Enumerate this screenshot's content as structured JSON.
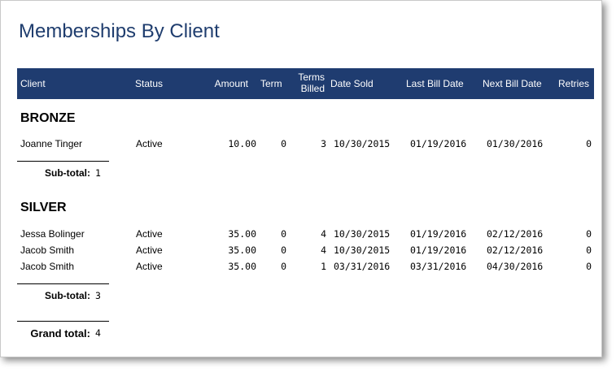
{
  "report": {
    "title": "Memberships By Client"
  },
  "header": {
    "client": "Client",
    "status": "Status",
    "amount": "Amount",
    "term": "Term",
    "terms_billed_line1": "Terms",
    "terms_billed_line2": "Billed",
    "date_sold": "Date Sold",
    "last_bill_date": "Last Bill Date",
    "next_bill_date": "Next Bill Date",
    "retries": "Retries"
  },
  "groups": [
    {
      "name": "BRONZE",
      "rows": [
        {
          "client": "Joanne Tinger",
          "status": "Active",
          "amount": "10.00",
          "term": "0",
          "terms_billed": "3",
          "date_sold": "10/30/2015",
          "last_bill_date": "01/19/2016",
          "next_bill_date": "01/30/2016",
          "retries": "0"
        }
      ],
      "subtotal_label": "Sub-total:",
      "subtotal_value": "1"
    },
    {
      "name": "SILVER",
      "rows": [
        {
          "client": "Jessa Bolinger",
          "status": "Active",
          "amount": "35.00",
          "term": "0",
          "terms_billed": "4",
          "date_sold": "10/30/2015",
          "last_bill_date": "01/19/2016",
          "next_bill_date": "02/12/2016",
          "retries": "0"
        },
        {
          "client": "Jacob Smith",
          "status": "Active",
          "amount": "35.00",
          "term": "0",
          "terms_billed": "4",
          "date_sold": "10/30/2015",
          "last_bill_date": "01/19/2016",
          "next_bill_date": "02/12/2016",
          "retries": "0"
        },
        {
          "client": "Jacob Smith",
          "status": "Active",
          "amount": "35.00",
          "term": "0",
          "terms_billed": "1",
          "date_sold": "03/31/2016",
          "last_bill_date": "03/31/2016",
          "next_bill_date": "04/30/2016",
          "retries": "0"
        }
      ],
      "subtotal_label": "Sub-total:",
      "subtotal_value": "3"
    }
  ],
  "grand_total": {
    "label": "Grand total:",
    "value": "4"
  },
  "colors": {
    "header_bg": "#1f3c70",
    "title": "#1f3d6e"
  }
}
